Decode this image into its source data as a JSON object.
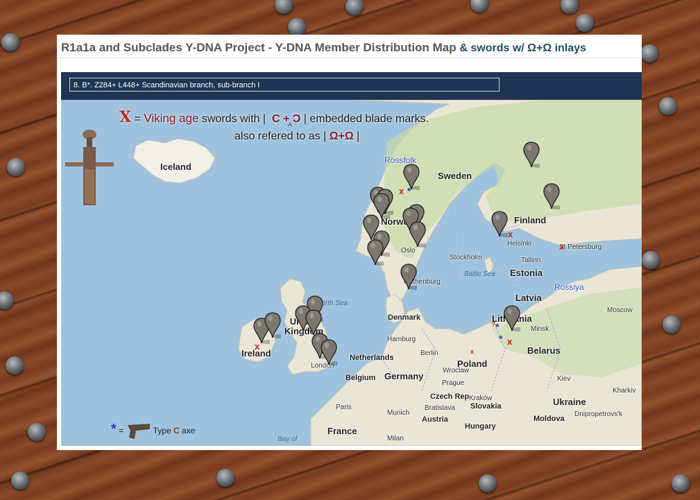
{
  "header": {
    "title_main": "R1a1a and Subclades Y-DNA Project - Y-DNA Member Distribution Map",
    "title_extra": "& swords w/ Ω+Ω inlays"
  },
  "selector": {
    "value": "8. B*. Z284+ L448+ Scandinavian branch, sub-branch I"
  },
  "legend": {
    "x_symbol": "X",
    "eq": "=",
    "viking_age": "Viking age",
    "swords_with": "swords with |",
    "marks_symbol": "C + Ɔ",
    "embedded": "| embedded blade marks.",
    "caret": "^",
    "also": "also refered to as |",
    "omega": "Ω+Ω",
    "close_bar": "|",
    "axe_star": "*",
    "axe_eq": "=",
    "axe_type": "Type",
    "axe_c": "C",
    "axe_word": "axe"
  },
  "map": {
    "countries": [
      "Iceland",
      "Sweden",
      "Norway",
      "Finland",
      "Estonia",
      "Latvia",
      "Lithuania",
      "Belarus",
      "Denmark",
      "Poland",
      "Germany",
      "Netherlands",
      "Belgium",
      "France",
      "United Kingdom",
      "Ireland",
      "Czech Rep",
      "Slovakia",
      "Austria",
      "Hungary",
      "Ukraine",
      "Moldova"
    ],
    "region_labels": [
      "Rössfolk",
      "Rossiya"
    ],
    "seas": [
      "North Sea",
      "Baltic Sea",
      "Bay of"
    ],
    "cities": [
      "Oslo",
      "Helsinki",
      "St Petersburg",
      "Stockholm",
      "Tallinn",
      "Gothenburg",
      "Moscow",
      "Hamburg",
      "Berlin",
      "Minsk",
      "London",
      "Paris",
      "Prague",
      "Bratislava",
      "Munich",
      "Milan",
      "Kiev",
      "Kharkiv",
      "Dnipropetrovs'k",
      "Wroclaw",
      "Kraków"
    ],
    "colors": {
      "water": "#9fc3de",
      "land": "#e8e4d6",
      "forest": "#b9d39a",
      "pin": "#7d786f",
      "mark": "#c0281e",
      "axe": "#1a3fd0"
    }
  }
}
